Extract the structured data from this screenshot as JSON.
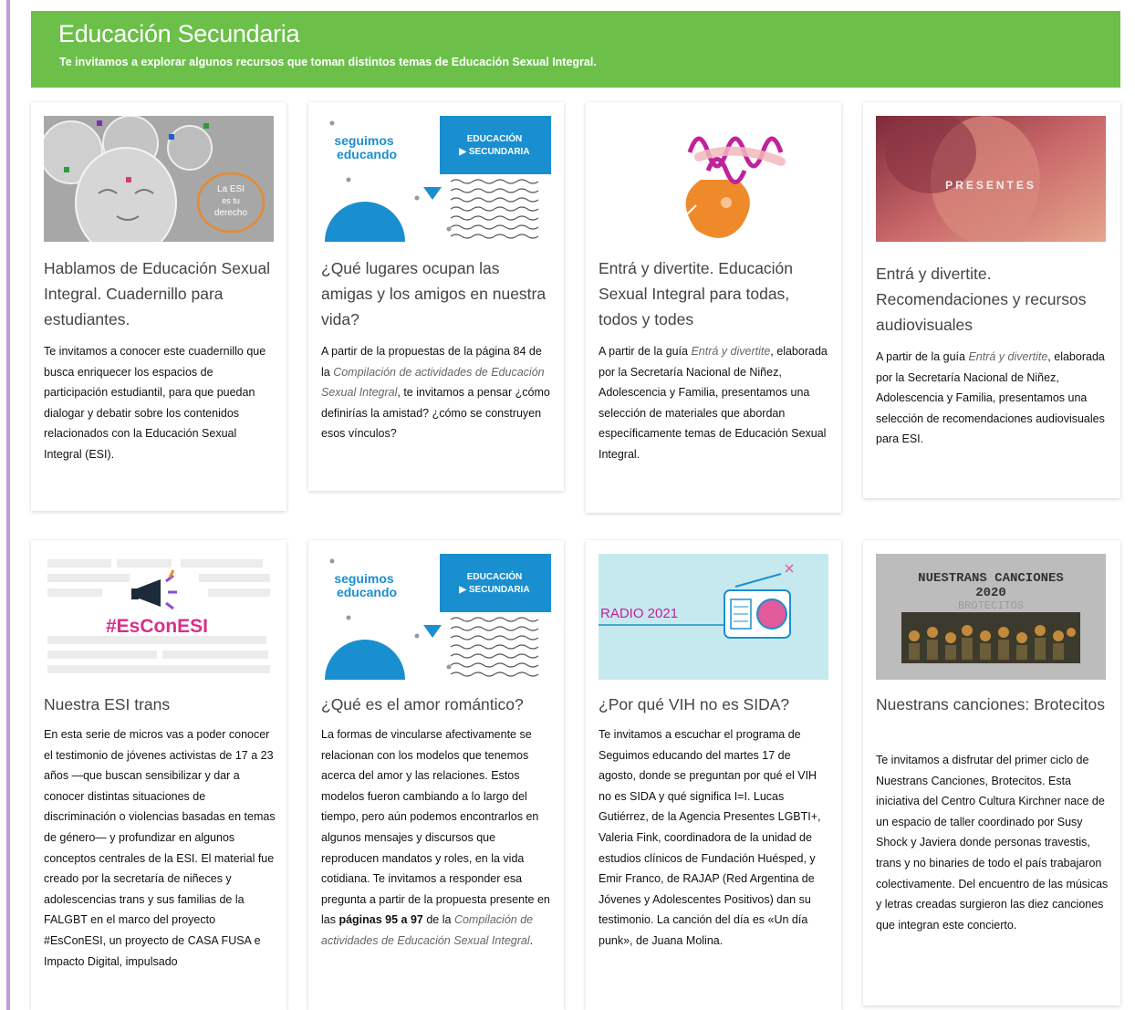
{
  "banner": {
    "title": "Educación Secundaria",
    "subtitle": "Te invitamos a explorar algunos recursos que toman distintos temas de Educación Sexual Integral."
  },
  "colors": {
    "banner": "#6cc04a",
    "accent_blue": "#1a8fcf",
    "accent_purple": "#c59ad6"
  },
  "cards": [
    {
      "title": "Hablamos de Educación Sexual Integral. Cuadernillo para estudiantes.",
      "desc_plain": "Te invitamos a conocer este cuadernillo que busca enriquecer los espacios de participación estudiantil, para que puedan dialogar y debatir sobre los contenidos relacionados con la Educación Sexual Integral (ESI).",
      "thumb_text": [
        "La ESI",
        "es tu",
        "derecho"
      ]
    },
    {
      "title": "¿Qué lugares ocupan las amigas y los amigos en nuestra vida?",
      "desc_pre": "A partir de la propuestas de la página 84 de la ",
      "desc_em": "Compilación de actividades de Educación Sexual Integral",
      "desc_post": ", te invitamos a pensar ¿cómo definirías la amistad? ¿cómo se construyen esos vínculos?",
      "thumb_text": [
        "seguimos",
        "educando",
        "EDUCACIÓN",
        "▶ SECUNDARIA"
      ]
    },
    {
      "title": "Entrá y divertite. Educación Sexual Integral para todas, todos y todes",
      "desc_pre": "A partir de la guía ",
      "desc_em": "Entrá y divertite",
      "desc_post": ", elaborada por la Secretaría Nacional de Niñez, Adolescencia y Familia, presentamos una selección de materiales que abordan específicamente temas de Educación Sexual Integral."
    },
    {
      "title": "Entrá y divertite. Recomendaciones y recursos audiovisuales",
      "desc_pre": "A partir de la guía ",
      "desc_em": "Entrá y divertite",
      "desc_post": ", elaborada por la Secretaría Nacional de Niñez, Adolescencia y Familia, presentamos una selección de recomendaciones audiovisuales para ESI.",
      "thumb_text": [
        "PRESENTES"
      ]
    },
    {
      "title": "Nuestra ESI trans",
      "desc_plain": "En esta serie de micros vas a poder conocer el testimonio de jóvenes activistas de 17 a 23 años —que buscan sensibilizar y dar a conocer distintas situaciones de discriminación o violencias basadas en temas de género— y profundizar en algunos conceptos centrales de la ESI. El material fue creado por la secretaría de niñeces y adolescencias trans y sus familias de la FALGBT en el marco del proyecto #EsConESI, un proyecto de CASA FUSA e Impacto Digital, impulsado",
      "thumb_text": [
        "#EsConESI"
      ]
    },
    {
      "title": "¿Qué es el amor romántico?",
      "desc_pre": "La formas de vincularse afectivamente se relacionan con los modelos que tenemos acerca del amor y las relaciones. Estos modelos fueron cambiando a lo largo del tiempo, pero aún podemos encontrarlos en algunos mensajes y discursos que reproducen mandatos y roles, en la vida cotidiana. Te invitamos a responder esa pregunta a partir de la propuesta presente en las ",
      "desc_bold": "páginas 95 a 97",
      "desc_mid": " de la ",
      "desc_em": "Compilación de actividades de Educación Sexual Integral",
      "desc_post": ".",
      "thumb_text": [
        "seguimos",
        "educando",
        "EDUCACIÓN",
        "▶ SECUNDARIA"
      ]
    },
    {
      "title": "¿Por qué VIH no es SIDA?",
      "desc_plain": "Te invitamos a escuchar el programa de Seguimos educando del martes 17 de agosto, donde se preguntan por qué el VIH no es SIDA y qué significa I=I. Lucas Gutiérrez, de la Agencia Presentes LGBTI+, Valeria Fink, coordinadora de la unidad de estudios clínicos de Fundación Huésped, y Emir Franco, de RAJAP (Red Argentina de Jóvenes y Adolescentes Positivos) dan su testimonio. La canción del día es «Un día punk», de Juana Molina.",
      "thumb_text": [
        "RADIO 2021"
      ]
    },
    {
      "title": "Nuestrans canciones: Brotecitos",
      "desc_plain": "Te invitamos a disfrutar del primer ciclo de Nuestrans Canciones, Brotecitos. Esta iniciativa del Centro Cultura Kirchner nace de un espacio de taller coordinado por Susy Shock y Javiera donde personas travestis, trans y no binaries de todo el país trabajaron colectivamente. Del encuentro de las músicas y letras creadas surgieron las diez canciones que integran este concierto.",
      "thumb_text": [
        "NUESTRANS CANCIONES",
        "2020",
        "BROTECITOS"
      ]
    }
  ]
}
